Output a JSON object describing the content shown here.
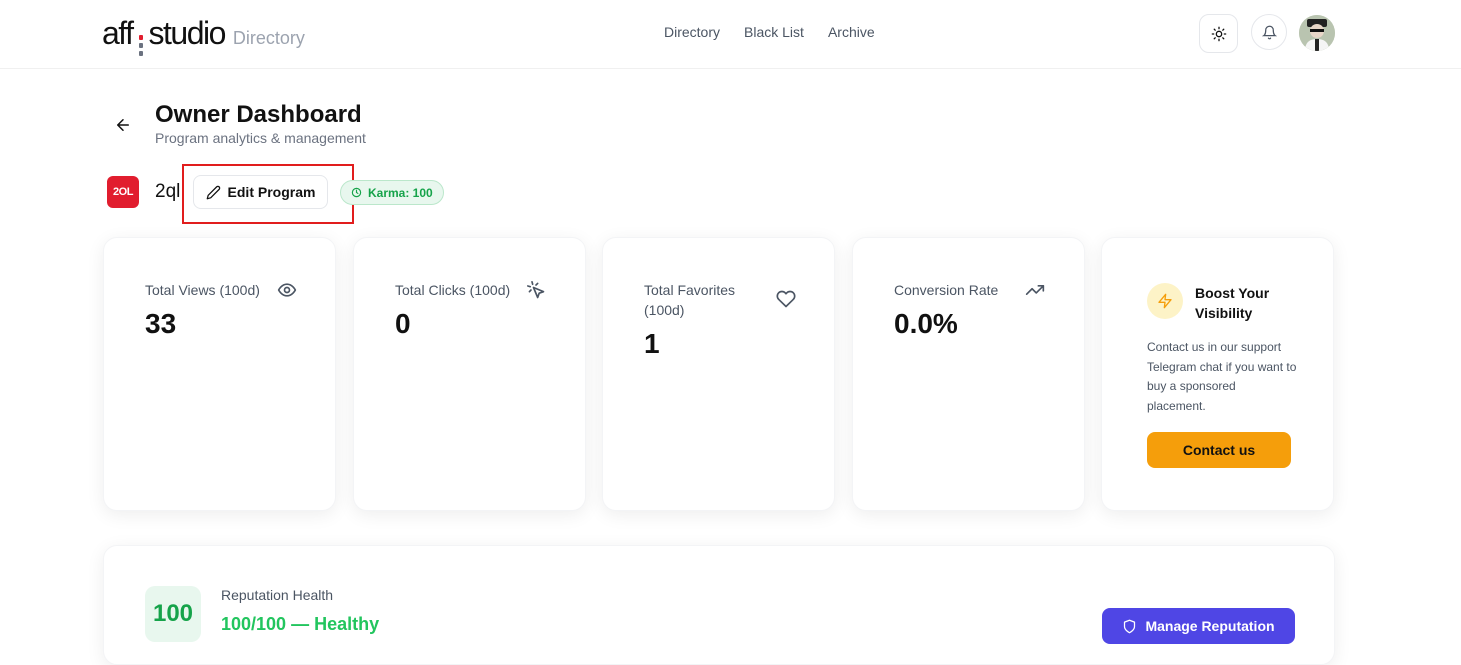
{
  "header": {
    "logo_left": "aff",
    "logo_right": "studio",
    "logo_sub": "Directory",
    "nav": [
      "Directory",
      "Black List",
      "Archive"
    ]
  },
  "page": {
    "title": "Owner Dashboard",
    "subtitle": "Program analytics & management"
  },
  "program": {
    "logo_text": "2OL",
    "name": "2ql",
    "edit_label": "Edit Program",
    "karma": "Karma: 100"
  },
  "stats": [
    {
      "label": "Total Views (100d)",
      "value": "33",
      "icon": "eye-icon"
    },
    {
      "label": "Total Clicks (100d)",
      "value": "0",
      "icon": "cursor-click-icon"
    },
    {
      "label": "Total Favorites (100d)",
      "value": "1",
      "icon": "heart-icon"
    },
    {
      "label": "Conversion Rate",
      "value": "0.0%",
      "icon": "trending-up-icon"
    }
  ],
  "boost": {
    "title": "Boost Your Visibility",
    "text": "Contact us in our support Telegram chat if you want to buy a sponsored placement.",
    "button": "Contact us"
  },
  "reputation": {
    "score": "100",
    "label": "Reputation Health",
    "status": "100/100 — Healthy",
    "button": "Manage Reputation"
  },
  "colors": {
    "accent_orange": "#f59e0b",
    "accent_indigo": "#4f46e5",
    "healthy_green": "#22c55e",
    "brand_red": "#e11d2e"
  }
}
